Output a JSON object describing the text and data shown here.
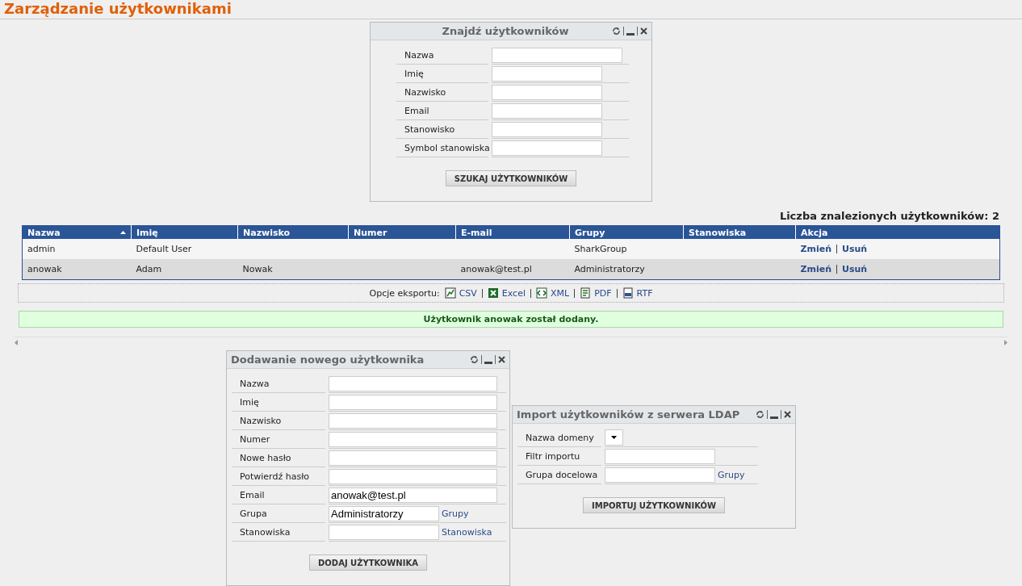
{
  "page_title": "Zarządzanie użytkownikami",
  "search_panel": {
    "title": "Znajdź użytkowników",
    "rows": [
      {
        "label": "Nazwa",
        "kind": "text"
      },
      {
        "label": "Imię",
        "kind": "text"
      },
      {
        "label": "Nazwisko",
        "kind": "text"
      },
      {
        "label": "Email",
        "kind": "text"
      },
      {
        "label": "Stanowisko",
        "kind": "text"
      },
      {
        "label": "Symbol stanowiska",
        "kind": "text"
      }
    ],
    "button": "SZUKAJ UŻYTKOWNIKÓW"
  },
  "result_count": "Liczba znalezionych użytkowników: 2",
  "table": {
    "columns": [
      {
        "label": "Nazwa",
        "sorted": true
      },
      {
        "label": "Imię",
        "sorted": false
      },
      {
        "label": "Nazwisko",
        "sorted": false
      },
      {
        "label": "Numer",
        "sorted": false
      },
      {
        "label": "E-mail",
        "sorted": false
      },
      {
        "label": "Grupy",
        "sorted": false
      },
      {
        "label": "Stanowiska",
        "sorted": false
      },
      {
        "label": "Akcja",
        "sorted": false
      }
    ],
    "rows": [
      {
        "cells": [
          "admin",
          "Default User",
          null,
          null,
          null,
          "SharkGroup",
          null
        ],
        "actions": [
          "Zmień",
          "Usuń"
        ]
      },
      {
        "cells": [
          "anowak",
          "Adam",
          "Nowak",
          null,
          "anowak@test.pl",
          "Administratorzy",
          null
        ],
        "actions": [
          "Zmień",
          "Usuń"
        ]
      }
    ]
  },
  "export": {
    "label": "Opcje eksportu:",
    "options": [
      "CSV",
      "Excel",
      "XML",
      "PDF",
      "RTF"
    ]
  },
  "message": "Użytkownik anowak został dodany.",
  "panels": [
    {
      "title": "Dodawanie nowego użytkownika",
      "rows": [
        {
          "label": "Nazwa",
          "kind": "text"
        },
        {
          "label": "Imię",
          "kind": "text"
        },
        {
          "label": "Nazwisko",
          "kind": "text"
        },
        {
          "label": "Numer",
          "kind": "text"
        },
        {
          "label": "Nowe hasło",
          "kind": "text"
        },
        {
          "label": "Potwierdź hasło",
          "kind": "text"
        },
        {
          "label": "Email",
          "kind": "text",
          "value": "anowak@test.pl"
        },
        {
          "label": "Grupa",
          "kind": "text",
          "value": "Administratorzy",
          "link": "Grupy"
        },
        {
          "label": "Stanowiska",
          "kind": "text",
          "link": "Stanowiska"
        }
      ],
      "button": "DODAJ UŻYTKOWNIKA"
    },
    {
      "title": "Import użytkowników z serwera LDAP",
      "rows": [
        {
          "label": "Nazwa domeny",
          "kind": "select"
        },
        {
          "label": "Filtr importu",
          "kind": "text"
        },
        {
          "label": "Grupa docelowa",
          "kind": "text",
          "link": "Grupy"
        }
      ],
      "button": "IMPORTUJ UŻYTKOWNIKÓW"
    }
  ]
}
